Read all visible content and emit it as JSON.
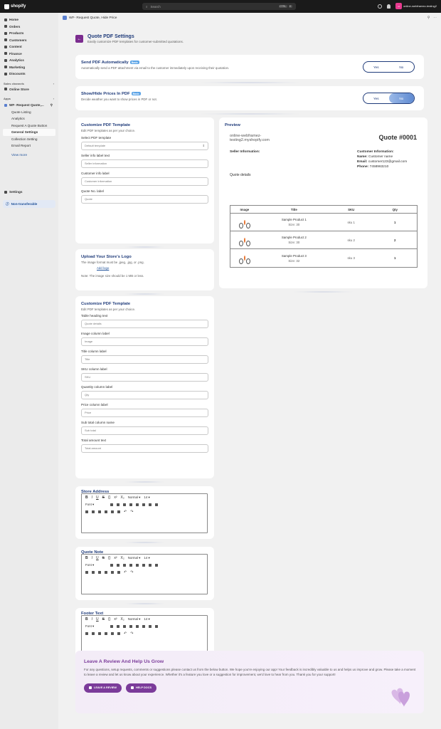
{
  "topbar": {
    "logo": "shopify",
    "search_placeholder": "Search",
    "kbd": [
      "CTRL",
      "K"
    ],
    "store_initials": "ot",
    "store_name": "online-webframez-testing2"
  },
  "sidebar": {
    "items": [
      "Home",
      "Orders",
      "Products",
      "Customers",
      "Content",
      "Finance",
      "Analytics",
      "Marketing",
      "Discounts"
    ],
    "sales_channels_title": "Sales channels",
    "sales_channels": [
      "Online Store"
    ],
    "apps_title": "Apps",
    "app_name": "WF- Request Quote,...",
    "app_subitems": [
      "Quote Listing",
      "Analytics",
      "Request A Quote Button",
      "General Settings",
      "Collection Setting",
      "Email Report"
    ],
    "view_more": "View more",
    "settings": "Settings",
    "non_transferable": "Non-transferable"
  },
  "app_header": {
    "title": "WF- Request Quote, Hide Price"
  },
  "page": {
    "title": "Quote PDF Settings",
    "subtitle": "Easily customize PDF templates for customer-submitted quotations."
  },
  "send_pdf": {
    "title": "Send PDF Automatically",
    "badge": "Basic",
    "desc": "Automatically send a PDF attachment via email to the customer immediately upon receiving their quotation.",
    "yes": "Yes",
    "no": "No"
  },
  "hide_prices": {
    "title": "Show/Hide Prices In PDF",
    "badge": "Basic",
    "desc": "Decide weather you want to show prices in PDF or not.",
    "yes": "Yes",
    "no": "No"
  },
  "customize1": {
    "title": "Customize PDF Template",
    "desc": "Edit PDF templates as per your choice.",
    "select_label": "Select PDF template",
    "select_value": "Default template",
    "seller_label": "Seller info label text",
    "seller_placeholder": "Seller information",
    "customer_label": "Customer info label",
    "customer_placeholder": "Customer information",
    "quote_label": "Quote No. label",
    "quote_placeholder": "Quote"
  },
  "logo": {
    "title": "Upload Your Store's Logo",
    "desc": "The image format must be .jpeg, .jpg, or .png.",
    "add": "Add logo",
    "note": "Note: The image size should be 1 MB or less."
  },
  "customize2": {
    "title": "Customize PDF Template",
    "desc": "Edit PDF templates as per your choice.",
    "fields": [
      {
        "label": "Table heading text",
        "placeholder": "Quote details"
      },
      {
        "label": "Image column label",
        "placeholder": "Image"
      },
      {
        "label": "Title column label",
        "placeholder": "Title"
      },
      {
        "label": "SKU column label",
        "placeholder": "SKU"
      },
      {
        "label": "Quantity column label",
        "placeholder": "Qty"
      },
      {
        "label": "Price column label",
        "placeholder": "Price"
      },
      {
        "label": "Sub total column name",
        "placeholder": "Sub total"
      },
      {
        "label": "Total amount text",
        "placeholder": "Total amount"
      }
    ]
  },
  "editor": {
    "font_size": "Normal",
    "size": "14",
    "font": "Font"
  },
  "store_address": {
    "title": "Store Address"
  },
  "quote_note": {
    "title": "Quote Note"
  },
  "footer_text": {
    "title": "Footer Text"
  },
  "preview": {
    "title": "Preview",
    "store_url": "online-webframez-testing2.myshopify.com",
    "quote_no": "Quote #0001",
    "seller_info": "Seller Information:",
    "customer_info": "Customer Information:",
    "name_label": "Name:",
    "name": "Customer name",
    "email_label": "Email:",
    "email": "customer123@gmail.com",
    "phone_label": "Phone:",
    "phone": "7458963210",
    "details": "Quote details",
    "headers": [
      "Image",
      "Title",
      "SKU",
      "Qty"
    ],
    "rows": [
      {
        "title": "Sample Product 1",
        "size": "Size: 30",
        "sku": "sku 1",
        "qty": "1"
      },
      {
        "title": "Sample Product 2",
        "size": "Size: 30",
        "sku": "sku 2",
        "qty": "2"
      },
      {
        "title": "Sample Product 3",
        "size": "Size: 32",
        "sku": "sku 3",
        "qty": "1"
      }
    ]
  },
  "review": {
    "title": "Leave A Review And Help Us Grow",
    "text": "For any questions, setup requests, comments or suggestions please contact us from the below button. We hope you're enjoying our app! Your feedback is incredibly valuable to us and helps us improve and grow. Please take a moment to leave a review and let us know about your experience. Whether it's a feature you love or a suggestion for improvement, we'd love to hear from you. Thank you for your support!",
    "btn_review": "LEAVE A REVIEW",
    "btn_docs": "HELP DOCS"
  },
  "colors": {
    "accent": "#1f3b7a",
    "purple": "#7b3b9a"
  }
}
